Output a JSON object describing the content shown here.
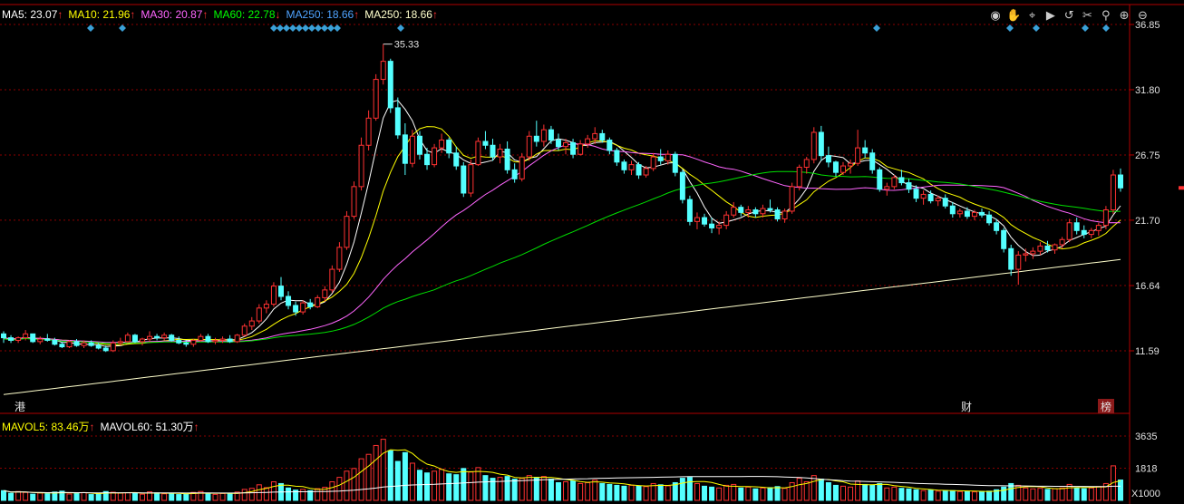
{
  "chart_data": {
    "type": "candlestick",
    "price_axis": {
      "ticks": [
        "36.85",
        "31.80",
        "26.75",
        "21.70",
        "16.64",
        "11.59"
      ]
    },
    "volume_axis": {
      "ticks": [
        "3635",
        "1818"
      ],
      "unit": "X1000"
    },
    "peak_label": "35.33",
    "legend": [
      {
        "label": "MA5: 23.07",
        "arrow": "↑",
        "color": "#ffffff"
      },
      {
        "label": "MA10: 21.96",
        "arrow": "↑",
        "color": "#ffff00"
      },
      {
        "label": "MA30: 20.87",
        "arrow": "↑",
        "color": "#ff66ff"
      },
      {
        "label": "MA60: 22.78",
        "arrow": "↓",
        "color": "#00ff00"
      },
      {
        "label": "MA250: 18.66",
        "arrow": "↑",
        "color": "#4fa3ff"
      },
      {
        "label": "MA250: 18.66",
        "arrow": "↑",
        "color": "#ffffcc"
      }
    ],
    "vol_legend": [
      {
        "label": "MAVOL5: 83.46万",
        "arrow": "↑",
        "color": "#ffff00"
      },
      {
        "label": "MAVOL60: 51.30万",
        "arrow": "↑",
        "color": "#ffffff"
      }
    ],
    "event_tags": [
      "港",
      "财",
      "榜"
    ],
    "colors": {
      "up": "#ff3232",
      "down": "#54ffff",
      "grid": "#8b0000",
      "axis": "#b00000",
      "marker": "#3aa0d8"
    },
    "candles": [
      [
        12.9,
        13.1,
        12.2,
        12.6
      ],
      [
        12.6,
        12.8,
        12.2,
        12.4
      ],
      [
        12.4,
        12.7,
        12.2,
        12.6
      ],
      [
        12.6,
        13.2,
        12.4,
        12.9
      ],
      [
        12.9,
        12.9,
        12.2,
        12.3
      ],
      [
        12.3,
        12.7,
        12.1,
        12.5
      ],
      [
        12.5,
        12.9,
        12.3,
        12.4
      ],
      [
        12.4,
        12.6,
        12.0,
        12.1
      ],
      [
        12.1,
        12.3,
        11.8,
        11.9
      ],
      [
        11.9,
        12.4,
        11.8,
        12.3
      ],
      [
        12.3,
        12.5,
        11.9,
        12.0
      ],
      [
        12.0,
        12.4,
        11.8,
        12.2
      ],
      [
        12.2,
        12.4,
        11.9,
        12.0
      ],
      [
        12.0,
        12.2,
        11.7,
        11.8
      ],
      [
        11.8,
        12.0,
        11.5,
        11.6
      ],
      [
        11.6,
        12.4,
        11.5,
        12.2
      ],
      [
        12.2,
        12.6,
        12.0,
        12.3
      ],
      [
        12.3,
        13.0,
        12.2,
        12.8
      ],
      [
        12.8,
        12.9,
        12.2,
        12.3
      ],
      [
        12.3,
        12.6,
        12.0,
        12.5
      ],
      [
        12.5,
        13.1,
        12.3,
        12.7
      ],
      [
        12.7,
        12.9,
        12.4,
        12.6
      ],
      [
        12.6,
        13.0,
        12.4,
        12.8
      ],
      [
        12.8,
        12.9,
        12.3,
        12.4
      ],
      [
        12.4,
        12.7,
        12.1,
        12.2
      ],
      [
        12.2,
        12.4,
        11.9,
        12.1
      ],
      [
        12.1,
        12.5,
        11.9,
        12.4
      ],
      [
        12.4,
        12.9,
        12.3,
        12.7
      ],
      [
        12.7,
        12.9,
        12.2,
        12.3
      ],
      [
        12.3,
        12.6,
        12.1,
        12.4
      ],
      [
        12.4,
        12.7,
        12.2,
        12.5
      ],
      [
        12.5,
        12.8,
        12.2,
        12.3
      ],
      [
        12.3,
        12.9,
        12.2,
        12.8
      ],
      [
        12.8,
        13.7,
        12.7,
        13.5
      ],
      [
        13.5,
        14.2,
        13.2,
        13.9
      ],
      [
        13.9,
        15.2,
        13.7,
        14.9
      ],
      [
        14.9,
        15.5,
        14.5,
        15.2
      ],
      [
        15.2,
        16.9,
        15.0,
        16.6
      ],
      [
        16.6,
        17.3,
        15.5,
        15.8
      ],
      [
        15.8,
        16.2,
        14.8,
        15.1
      ],
      [
        15.1,
        15.4,
        14.3,
        14.6
      ],
      [
        14.6,
        15.5,
        14.4,
        15.3
      ],
      [
        15.3,
        15.6,
        14.8,
        15.0
      ],
      [
        15.0,
        15.9,
        14.9,
        15.7
      ],
      [
        15.7,
        16.6,
        15.4,
        16.3
      ],
      [
        16.3,
        18.2,
        16.1,
        17.9
      ],
      [
        17.9,
        20.0,
        17.7,
        19.6
      ],
      [
        19.6,
        22.4,
        19.4,
        22.0
      ],
      [
        22.0,
        24.7,
        21.8,
        24.3
      ],
      [
        24.3,
        28.1,
        24.0,
        27.5
      ],
      [
        27.5,
        30.2,
        27.1,
        29.6
      ],
      [
        29.6,
        33.0,
        29.4,
        32.6
      ],
      [
        32.6,
        35.33,
        32.2,
        34.0
      ],
      [
        34.0,
        34.2,
        30.0,
        30.4
      ],
      [
        30.4,
        31.2,
        28.0,
        28.3
      ],
      [
        28.3,
        29.2,
        25.2,
        26.1
      ],
      [
        26.1,
        28.7,
        25.8,
        28.2
      ],
      [
        28.2,
        28.6,
        26.4,
        26.8
      ],
      [
        26.8,
        27.3,
        25.6,
        26.0
      ],
      [
        26.0,
        27.6,
        25.8,
        27.3
      ],
      [
        27.3,
        28.4,
        26.9,
        27.9
      ],
      [
        27.9,
        28.1,
        26.5,
        26.9
      ],
      [
        26.9,
        27.4,
        25.6,
        25.9
      ],
      [
        25.9,
        26.2,
        23.5,
        23.8
      ],
      [
        23.8,
        26.4,
        23.5,
        26.0
      ],
      [
        26.0,
        28.1,
        25.9,
        27.8
      ],
      [
        27.8,
        28.6,
        27.2,
        27.5
      ],
      [
        27.5,
        28.0,
        26.3,
        26.6
      ],
      [
        26.6,
        27.6,
        26.1,
        27.2
      ],
      [
        27.2,
        27.8,
        25.3,
        25.6
      ],
      [
        25.6,
        26.1,
        24.6,
        24.9
      ],
      [
        24.9,
        26.9,
        24.7,
        26.6
      ],
      [
        26.6,
        28.6,
        26.3,
        28.2
      ],
      [
        28.2,
        29.4,
        27.4,
        27.8
      ],
      [
        27.8,
        29.1,
        27.4,
        28.7
      ],
      [
        28.7,
        29.0,
        27.6,
        27.9
      ],
      [
        27.9,
        28.4,
        27.1,
        27.4
      ],
      [
        27.4,
        28.0,
        26.8,
        27.7
      ],
      [
        27.7,
        28.0,
        26.5,
        26.8
      ],
      [
        26.8,
        27.9,
        26.7,
        27.6
      ],
      [
        27.6,
        28.3,
        27.3,
        28.0
      ],
      [
        28.0,
        28.9,
        27.6,
        28.4
      ],
      [
        28.4,
        28.7,
        27.7,
        27.9
      ],
      [
        27.9,
        28.1,
        26.8,
        27.1
      ],
      [
        27.1,
        27.3,
        25.9,
        26.2
      ],
      [
        26.2,
        26.4,
        25.3,
        25.6
      ],
      [
        25.6,
        26.3,
        25.2,
        26.0
      ],
      [
        26.0,
        26.2,
        24.9,
        25.2
      ],
      [
        25.2,
        25.9,
        25.0,
        25.7
      ],
      [
        25.7,
        26.9,
        25.5,
        26.6
      ],
      [
        26.6,
        27.2,
        26.0,
        26.3
      ],
      [
        26.3,
        27.1,
        26.0,
        26.8
      ],
      [
        26.8,
        27.0,
        25.1,
        25.4
      ],
      [
        25.4,
        25.6,
        23.0,
        23.3
      ],
      [
        23.3,
        23.6,
        21.3,
        21.6
      ],
      [
        21.6,
        22.3,
        21.0,
        21.9
      ],
      [
        21.9,
        22.2,
        21.2,
        21.4
      ],
      [
        21.4,
        21.9,
        20.7,
        21.1
      ],
      [
        21.1,
        21.6,
        20.6,
        21.3
      ],
      [
        21.3,
        22.4,
        21.0,
        22.1
      ],
      [
        22.1,
        23.1,
        21.9,
        22.7
      ],
      [
        22.7,
        22.9,
        22.0,
        22.3
      ],
      [
        22.3,
        22.8,
        21.9,
        22.5
      ],
      [
        22.5,
        22.7,
        21.9,
        22.2
      ],
      [
        22.2,
        22.9,
        21.9,
        22.6
      ],
      [
        22.6,
        23.3,
        22.3,
        22.5
      ],
      [
        22.5,
        22.7,
        21.6,
        21.8
      ],
      [
        21.8,
        22.6,
        21.5,
        22.4
      ],
      [
        22.4,
        24.6,
        22.2,
        24.3
      ],
      [
        24.3,
        26.0,
        24.0,
        25.8
      ],
      [
        25.8,
        26.6,
        25.3,
        26.4
      ],
      [
        26.4,
        28.9,
        26.1,
        28.5
      ],
      [
        28.5,
        29.0,
        26.3,
        26.7
      ],
      [
        26.7,
        27.4,
        25.8,
        26.2
      ],
      [
        26.2,
        26.3,
        25.1,
        25.4
      ],
      [
        25.4,
        26.2,
        25.2,
        25.9
      ],
      [
        25.9,
        26.4,
        25.3,
        26.1
      ],
      [
        26.1,
        28.7,
        25.9,
        27.3
      ],
      [
        27.3,
        27.9,
        26.5,
        26.9
      ],
      [
        26.9,
        27.2,
        25.3,
        25.6
      ],
      [
        25.6,
        25.8,
        23.9,
        24.1
      ],
      [
        24.1,
        24.6,
        23.6,
        24.3
      ],
      [
        24.3,
        25.2,
        24.1,
        25.0
      ],
      [
        25.0,
        25.6,
        24.4,
        24.6
      ],
      [
        24.6,
        24.9,
        23.8,
        24.1
      ],
      [
        24.1,
        24.4,
        23.1,
        23.4
      ],
      [
        23.4,
        24.0,
        22.9,
        23.7
      ],
      [
        23.7,
        24.0,
        23.0,
        23.2
      ],
      [
        23.2,
        23.6,
        22.8,
        23.4
      ],
      [
        23.4,
        23.7,
        22.6,
        22.8
      ],
      [
        22.8,
        23.1,
        21.9,
        22.2
      ],
      [
        22.2,
        22.6,
        21.9,
        22.4
      ],
      [
        22.4,
        22.7,
        21.8,
        22.0
      ],
      [
        22.0,
        22.5,
        21.7,
        22.3
      ],
      [
        22.3,
        22.6,
        21.9,
        22.1
      ],
      [
        22.1,
        22.4,
        21.3,
        21.5
      ],
      [
        21.5,
        21.8,
        20.6,
        20.9
      ],
      [
        20.9,
        21.1,
        19.2,
        19.5
      ],
      [
        19.5,
        19.8,
        17.4,
        17.9
      ],
      [
        17.9,
        19.3,
        16.7,
        19.0
      ],
      [
        19.0,
        19.5,
        18.5,
        19.1
      ],
      [
        19.1,
        19.6,
        18.7,
        19.3
      ],
      [
        19.3,
        20.0,
        19.0,
        19.7
      ],
      [
        19.7,
        20.1,
        19.2,
        19.4
      ],
      [
        19.4,
        19.9,
        19.1,
        19.8
      ],
      [
        19.8,
        20.4,
        19.5,
        20.2
      ],
      [
        20.2,
        21.8,
        20.0,
        21.5
      ],
      [
        21.5,
        21.9,
        20.6,
        20.9
      ],
      [
        20.9,
        21.3,
        20.3,
        20.6
      ],
      [
        20.6,
        21.1,
        20.3,
        20.9
      ],
      [
        20.9,
        21.5,
        20.5,
        21.3
      ],
      [
        21.3,
        22.8,
        21.0,
        22.5
      ],
      [
        22.5,
        25.6,
        22.2,
        25.2
      ],
      [
        25.2,
        25.7,
        23.9,
        24.2
      ]
    ],
    "volumes": [
      0.55,
      0.4,
      0.5,
      0.45,
      0.35,
      0.42,
      0.38,
      0.47,
      0.52,
      0.36,
      0.4,
      0.44,
      0.33,
      0.37,
      0.5,
      0.46,
      0.41,
      0.43,
      0.39,
      0.35,
      0.48,
      0.42,
      0.37,
      0.4,
      0.33,
      0.36,
      0.45,
      0.5,
      0.38,
      0.34,
      0.39,
      0.36,
      0.47,
      0.62,
      0.68,
      0.88,
      0.72,
      1.05,
      0.95,
      0.7,
      0.58,
      0.62,
      0.55,
      0.66,
      0.74,
      1.05,
      1.3,
      1.65,
      1.8,
      2.35,
      2.6,
      3.1,
      3.45,
      2.8,
      2.2,
      2.7,
      2.1,
      1.7,
      1.55,
      1.65,
      1.75,
      1.5,
      1.45,
      1.8,
      1.6,
      1.85,
      1.4,
      1.25,
      1.3,
      1.35,
      1.2,
      1.25,
      1.4,
      1.3,
      1.35,
      1.2,
      1.0,
      1.05,
      1.1,
      0.95,
      1.0,
      1.15,
      0.95,
      0.9,
      0.85,
      0.8,
      0.85,
      0.8,
      0.78,
      0.95,
      0.88,
      0.82,
      1.0,
      1.25,
      1.3,
      0.95,
      0.8,
      0.75,
      0.7,
      0.85,
      0.9,
      0.7,
      0.75,
      0.65,
      0.7,
      0.72,
      0.78,
      0.68,
      1.0,
      1.25,
      1.05,
      1.4,
      1.2,
      1.0,
      0.85,
      0.8,
      0.75,
      1.1,
      0.9,
      0.85,
      0.95,
      0.7,
      0.75,
      0.68,
      0.65,
      0.6,
      0.55,
      0.58,
      0.52,
      0.56,
      0.55,
      0.5,
      0.52,
      0.48,
      0.5,
      0.52,
      0.6,
      0.75,
      0.95,
      0.85,
      0.7,
      0.65,
      0.68,
      0.62,
      0.66,
      0.7,
      0.9,
      0.72,
      0.66,
      0.7,
      0.78,
      0.95,
      1.95,
      1.15
    ]
  },
  "toolbar": {
    "icons": [
      "eye-icon",
      "hand-icon",
      "cursor-icon",
      "play-icon",
      "undo-icon",
      "scissors-icon",
      "pin-icon",
      "zoom-in-icon",
      "zoom-out-icon"
    ]
  }
}
